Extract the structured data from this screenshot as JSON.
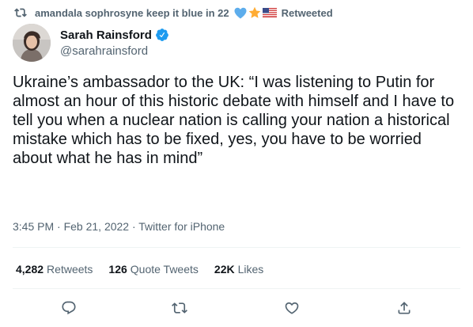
{
  "retweet_context": {
    "retweeter_name": "amandala sophrosyne keep it blue in 22",
    "suffix": "Retweeted",
    "emojis": [
      "blue-heart",
      "star",
      "us-flag"
    ]
  },
  "author": {
    "display_name": "Sarah Rainsford",
    "handle": "@sarahrainsford",
    "verified": true
  },
  "tweet": {
    "text": "Ukraine’s ambassador to the UK: “I was listening to Putin for almost an hour of this historic debate with himself and I have to tell you when a nuclear nation is calling your nation a historical mistake which has to be fixed, yes, you have to be worried about what he has in mind”",
    "timestamp": "3:45 PM · Feb 21, 2022 · Twitter for iPhone"
  },
  "stats": {
    "retweets_count": "4,282",
    "retweets_label": "Retweets",
    "quotes_count": "126",
    "quotes_label": "Quote Tweets",
    "likes_count": "22K",
    "likes_label": "Likes"
  },
  "actions": [
    "reply-icon",
    "retweet-icon",
    "like-icon",
    "share-icon"
  ],
  "colors": {
    "text": "#0f1419",
    "secondary": "#536471",
    "verified": "#1d9bf0",
    "divider": "#eff3f4"
  }
}
